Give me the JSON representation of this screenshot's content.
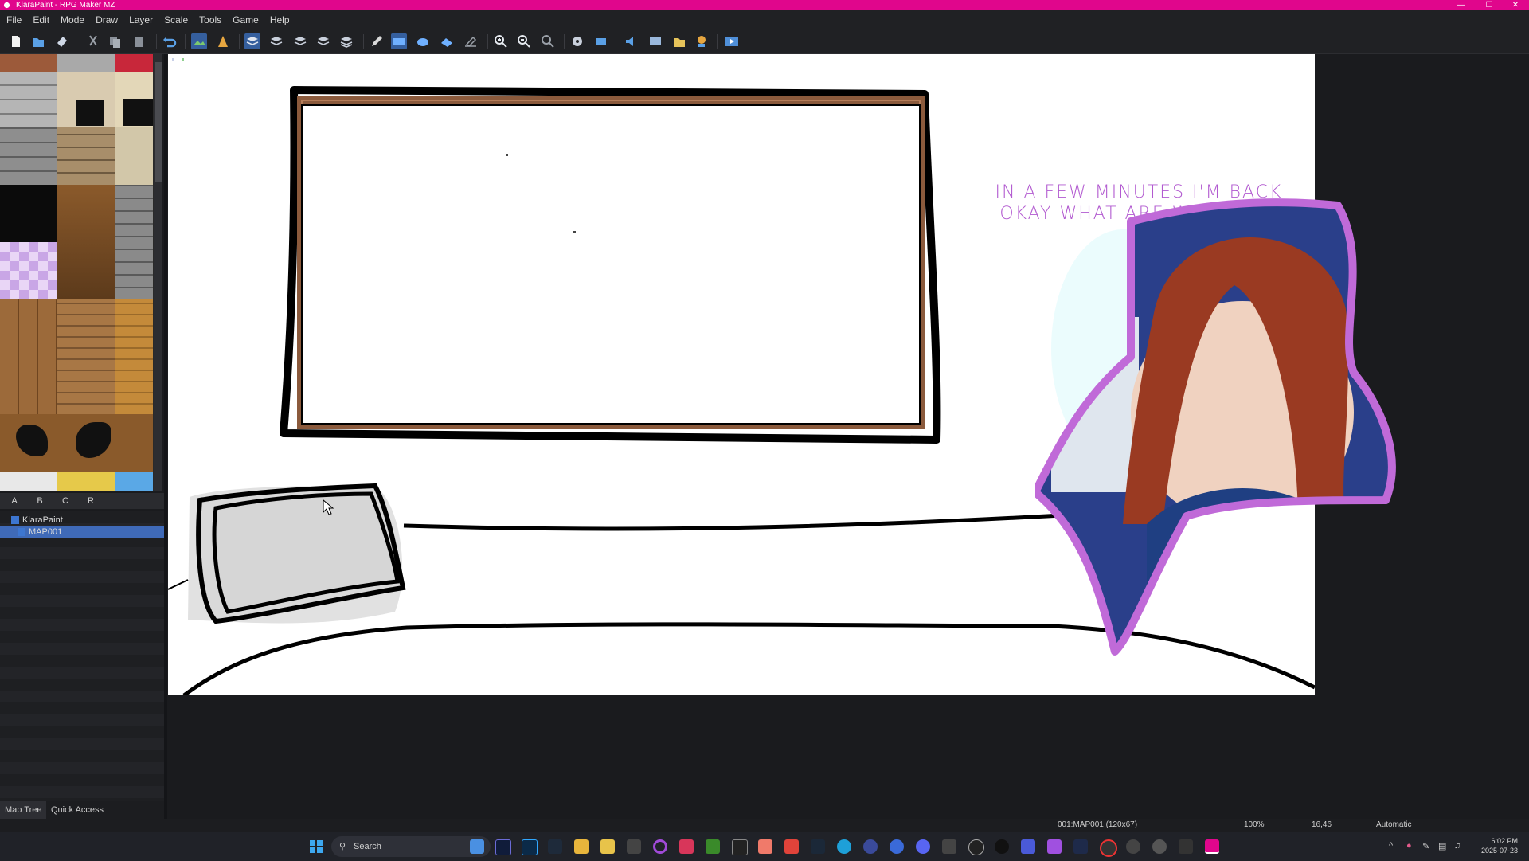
{
  "window": {
    "title": "KlaraPaint - RPG Maker MZ",
    "minimize": "—",
    "maximize": "☐",
    "close": "✕"
  },
  "menu": [
    "File",
    "Edit",
    "Mode",
    "Draw",
    "Layer",
    "Scale",
    "Tools",
    "Game",
    "Help"
  ],
  "tileset_tabs": [
    "A",
    "B",
    "C",
    "R"
  ],
  "map_tree": {
    "project": "KlaraPaint",
    "map": "MAP001"
  },
  "panel_tabs": [
    "Map Tree",
    "Quick Access"
  ],
  "status": {
    "map": "001:MAP001 (120x67)",
    "zoom": "100%",
    "coords": "16,46",
    "mode": "Automatic"
  },
  "overlay": {
    "line1": "IN A FEW MINUTES I'M BACK",
    "line2": "OKAY WHAT ARE WE DOING"
  },
  "taskbar": {
    "search_placeholder": "Search",
    "time": "6:02 PM",
    "date": "2025-07-23"
  },
  "colors": {
    "titlebar": "#e0068c",
    "accent": "#3f6ab8",
    "overlay_text": "#b25ad0",
    "frame_wood": "#8b5a3c"
  }
}
